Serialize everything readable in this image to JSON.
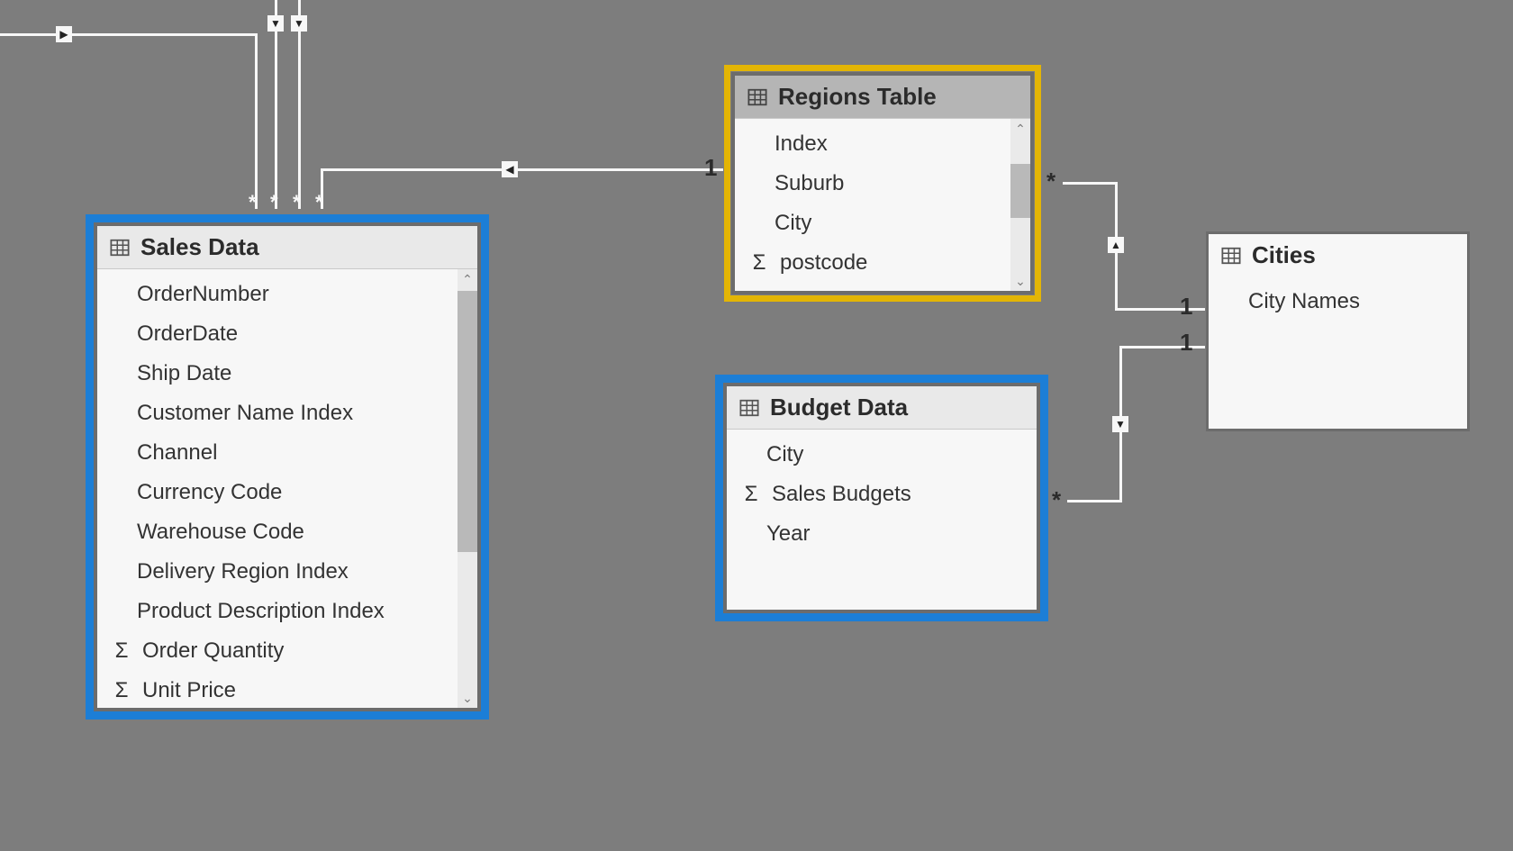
{
  "tables": {
    "sales": {
      "title": "Sales Data",
      "fields": [
        {
          "name": "OrderNumber",
          "agg": false
        },
        {
          "name": "OrderDate",
          "agg": false
        },
        {
          "name": "Ship Date",
          "agg": false
        },
        {
          "name": "Customer Name Index",
          "agg": false
        },
        {
          "name": "Channel",
          "agg": false
        },
        {
          "name": "Currency Code",
          "agg": false
        },
        {
          "name": "Warehouse Code",
          "agg": false
        },
        {
          "name": "Delivery Region Index",
          "agg": false
        },
        {
          "name": "Product Description Index",
          "agg": false
        },
        {
          "name": "Order Quantity",
          "agg": true
        },
        {
          "name": "Unit Price",
          "agg": true
        }
      ]
    },
    "regions": {
      "title": "Regions Table",
      "fields": [
        {
          "name": "Index",
          "agg": false
        },
        {
          "name": "Suburb",
          "agg": false
        },
        {
          "name": "City",
          "agg": false
        },
        {
          "name": "postcode",
          "agg": true
        }
      ]
    },
    "budget": {
      "title": "Budget Data",
      "fields": [
        {
          "name": "City",
          "agg": false
        },
        {
          "name": "Sales Budgets",
          "agg": true
        },
        {
          "name": "Year",
          "agg": false
        }
      ]
    },
    "cities": {
      "title": "Cities",
      "fields": [
        {
          "name": "City Names",
          "agg": false
        }
      ]
    }
  },
  "cardinality": {
    "one": "1",
    "many": "*"
  },
  "sigma_glyph": "Σ"
}
